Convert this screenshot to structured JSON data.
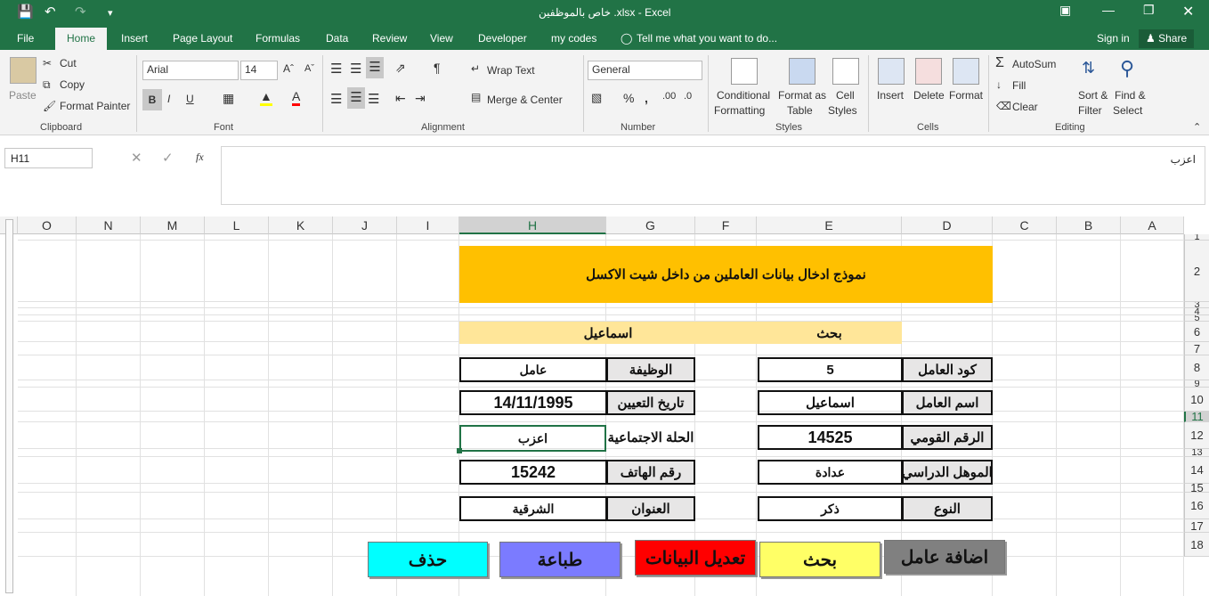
{
  "titlebar": {
    "title": "خاص بالموظفين .xlsx - Excel"
  },
  "tabs": [
    "File",
    "Home",
    "Insert",
    "Page Layout",
    "Formulas",
    "Data",
    "Review",
    "View",
    "Developer",
    "my codes"
  ],
  "tell_me": "Tell me what you want to do...",
  "sign_in": "Sign in",
  "share": "Share",
  "clipboard": {
    "paste": "Paste",
    "cut": "Cut",
    "copy": "Copy",
    "format_painter": "Format Painter",
    "label": "Clipboard"
  },
  "font": {
    "name": "Arial",
    "size": "14",
    "label": "Font"
  },
  "alignment": {
    "wrap": "Wrap Text",
    "merge": "Merge & Center",
    "label": "Alignment"
  },
  "number": {
    "format": "General",
    "label": "Number"
  },
  "styles": {
    "cond1": "Conditional",
    "cond2": "Formatting",
    "fmt1": "Format as",
    "fmt2": "Table",
    "cell1": "Cell",
    "cell2": "Styles",
    "label": "Styles"
  },
  "cells": {
    "insert": "Insert",
    "delete": "Delete",
    "format": "Format",
    "label": "Cells"
  },
  "editing": {
    "autosum": "AutoSum",
    "fill": "Fill",
    "clear": "Clear",
    "sort1": "Sort &",
    "sort2": "Filter",
    "find1": "Find &",
    "find2": "Select",
    "label": "Editing"
  },
  "formula_bar": {
    "name_box": "H11",
    "fx": "fx",
    "content": "اعزب"
  },
  "columns": [
    "O",
    "N",
    "M",
    "L",
    "K",
    "J",
    "I",
    "H",
    "G",
    "F",
    "E",
    "D",
    "C",
    "B",
    "A"
  ],
  "rows": [
    "1",
    "2",
    "3",
    "4",
    "5",
    "6",
    "7",
    "8",
    "9",
    "10",
    "11",
    "12",
    "13",
    "14",
    "15",
    "16",
    "17",
    "18"
  ],
  "sheet": {
    "title": "نموذج ادخال بيانات العاملين من داخل شيت الاكسل",
    "search_label": "بحث",
    "search_value": "اسماعيل",
    "worker_code_label": "كود العامل",
    "worker_code": "5",
    "worker_name_label": "اسم العامل",
    "worker_name": "اسماعيل",
    "national_id_label": "الرقم القومي",
    "national_id": "14525",
    "qualification_label": "الموهل الدراسي",
    "qualification": "عدادة",
    "gender_label": "النوع",
    "gender": "ذكر",
    "job_label": "الوظيفة",
    "job": "عامل",
    "hire_date_label": "تاريخ التعيين",
    "hire_date": "14/11/1995",
    "marital_label": "الحلة الاجتماعية",
    "marital": "اعزب",
    "phone_label": "رقم الهاتف",
    "phone": "15242",
    "address_label": "العنوان",
    "address": "الشرقية"
  },
  "buttons": {
    "add": "اضافة عامل",
    "search": "بحث",
    "edit": "تعديل البيانات",
    "print": "طباعة",
    "delete": "حذف"
  },
  "colors": {
    "excel_green": "#217346",
    "header_orange": "#ffc000",
    "search_bar": "#ffe699",
    "add_btn": "#808080",
    "search_btn": "#ffff66",
    "edit_btn": "#ff0000",
    "print_btn": "#7b7bff",
    "delete_btn": "#00ffff"
  }
}
